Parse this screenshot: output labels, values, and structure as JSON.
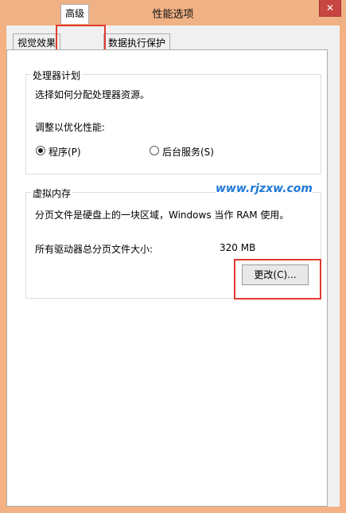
{
  "window": {
    "title": "性能选项",
    "close_glyph": "✕"
  },
  "tabs": [
    {
      "label": "视觉效果",
      "active": false
    },
    {
      "label": "高级",
      "active": true
    },
    {
      "label": "数据执行保护",
      "active": false
    }
  ],
  "processor": {
    "title": "处理器计划",
    "description": "选择如何分配处理器资源。",
    "adjust_label": "调整以优化性能:",
    "options": [
      {
        "label": "程序(P)",
        "checked": true
      },
      {
        "label": "后台服务(S)",
        "checked": false
      }
    ]
  },
  "virtual_memory": {
    "title": "虚拟内存",
    "description": "分页文件是硬盘上的一块区域，Windows 当作 RAM 使用。",
    "total_label": "所有驱动器总分页文件大小:",
    "total_value": "320 MB",
    "change_button": "更改(C)..."
  },
  "watermark": "www.rjzxw.com",
  "colors": {
    "frame": "#f0b184",
    "highlight": "#e03b30",
    "watermark": "#1f7ad6"
  }
}
